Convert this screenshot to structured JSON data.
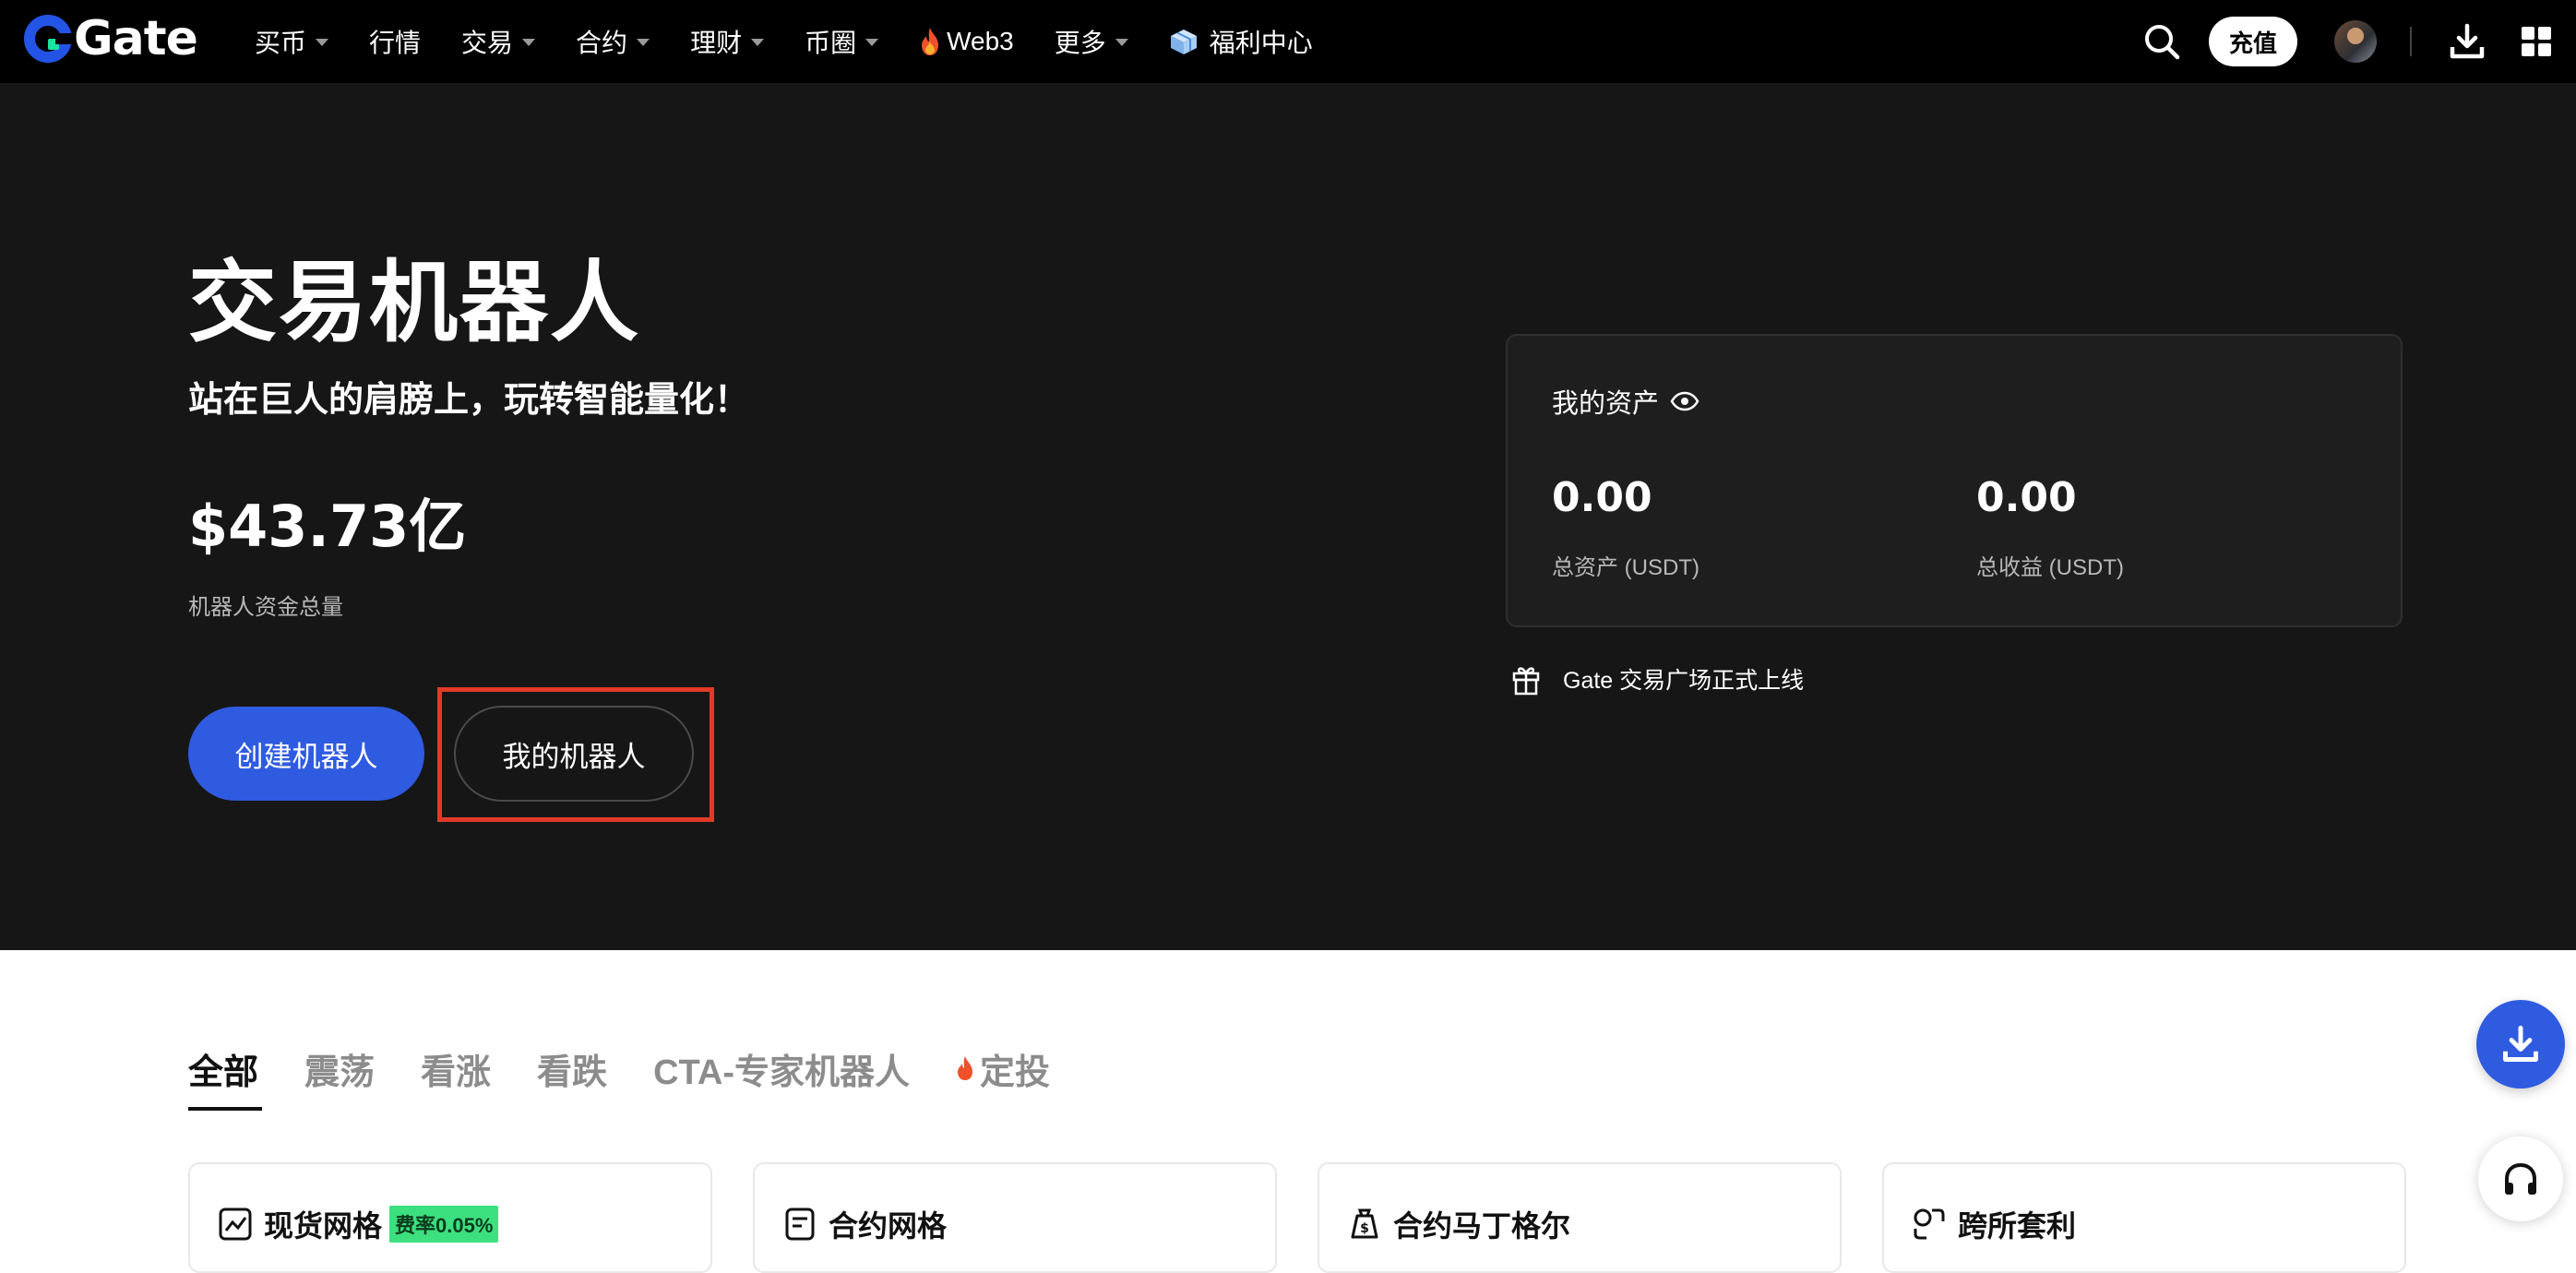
{
  "nav": {
    "logo_text": "Gate",
    "items": [
      {
        "label": "买币",
        "has_caret": true
      },
      {
        "label": "行情",
        "has_caret": false
      },
      {
        "label": "交易",
        "has_caret": true
      },
      {
        "label": "合约",
        "has_caret": true
      },
      {
        "label": "理财",
        "has_caret": true
      },
      {
        "label": "币圈",
        "has_caret": true
      },
      {
        "label": "Web3",
        "icon": "fire-icon"
      },
      {
        "label": "更多",
        "has_caret": true
      },
      {
        "label": "福利中心",
        "icon": "gift-box-icon"
      }
    ],
    "deposit_label": "充值"
  },
  "hero": {
    "title": "交易机器人",
    "subtitle": "站在巨人的肩膀上，玩转智能量化！",
    "amount": "$43.73亿",
    "amount_label": "机器人资金总量",
    "create_button": "创建机器人",
    "my_bots_button": "我的机器人"
  },
  "assets": {
    "title": "我的资产",
    "total_value": "0.00",
    "total_label": "总资产 (USDT)",
    "profit_value": "0.00",
    "profit_label": "总收益 (USDT)"
  },
  "announcement": "Gate 交易广场正式上线",
  "tabs": [
    {
      "label": "全部",
      "active": true
    },
    {
      "label": "震荡"
    },
    {
      "label": "看涨"
    },
    {
      "label": "看跌"
    },
    {
      "label": "CTA-专家机器人"
    },
    {
      "label": "定投",
      "icon": "fire-icon"
    }
  ],
  "cards": [
    {
      "title": "现货网格",
      "badge": "费率0.05%",
      "icon": "chart-box-icon"
    },
    {
      "title": "合约网格",
      "icon": "document-icon"
    },
    {
      "title": "合约马丁格尔",
      "icon": "dollar-bag-icon"
    },
    {
      "title": "跨所套利",
      "icon": "arbitrage-icon"
    }
  ],
  "colors": {
    "accent_blue": "#2f5be0",
    "highlight_red": "#e13a28",
    "badge_green": "#3ce07e",
    "hero_bg": "#161616"
  }
}
